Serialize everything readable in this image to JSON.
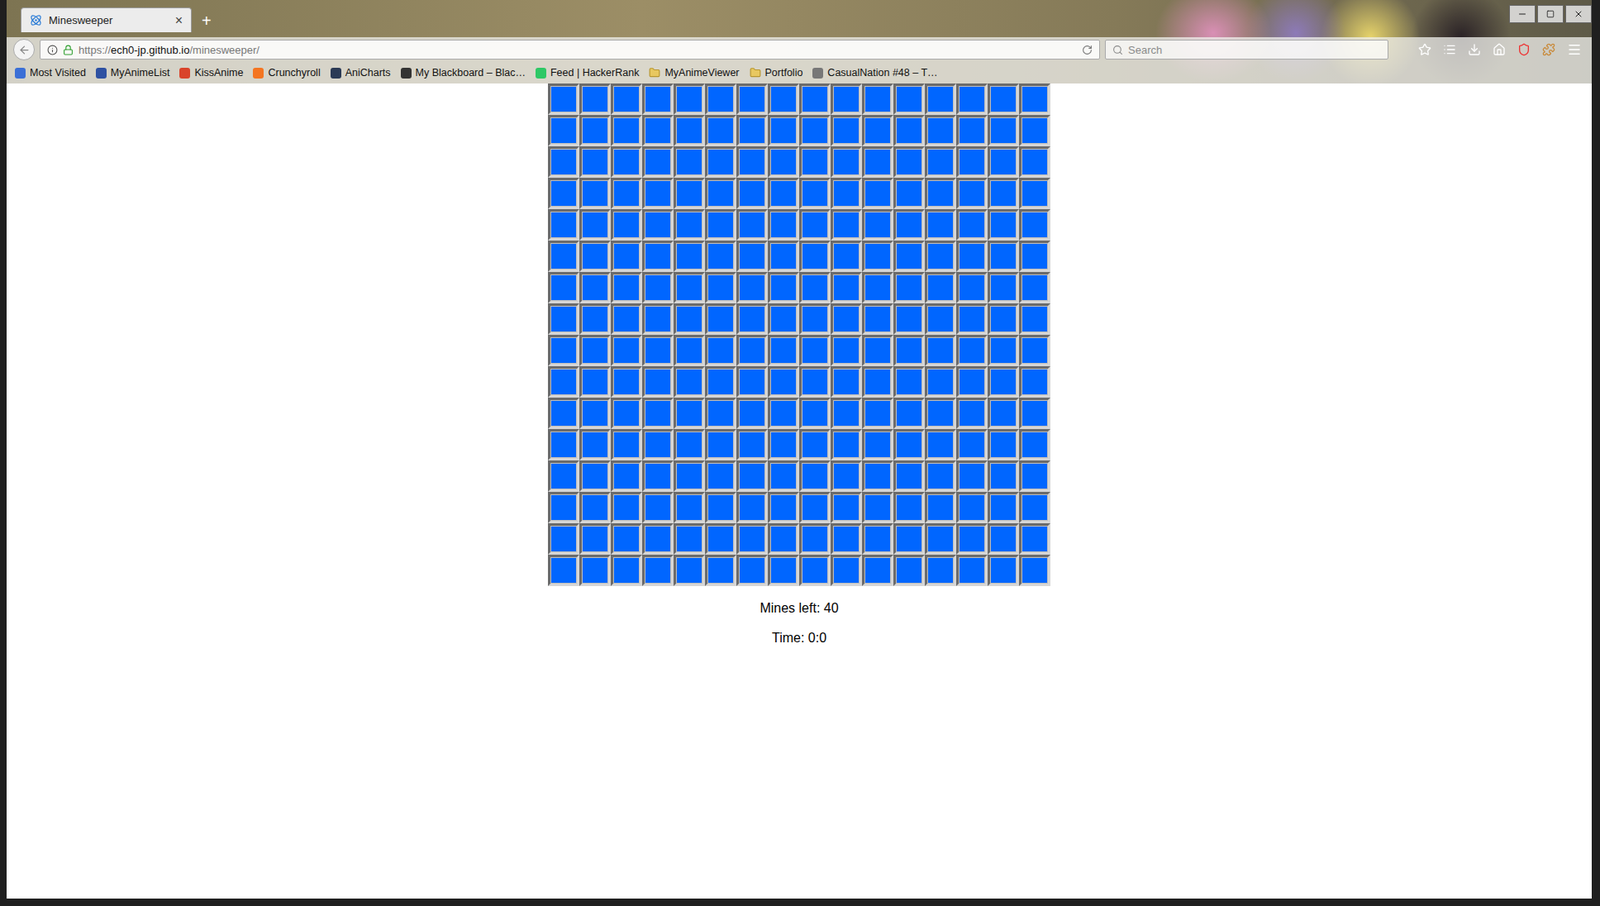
{
  "tabs": [
    {
      "label": "Minesweeper",
      "selected": true,
      "close": "×"
    }
  ],
  "new_tab": "+",
  "address_bar": {
    "scheme": "https://",
    "host": "ech0-jp.github.io",
    "path": "/minesweeper/"
  },
  "search": {
    "placeholder": "Search"
  },
  "bookmarks": [
    {
      "label": "Most Visited",
      "kind": "link",
      "color": "#3b6fd6"
    },
    {
      "label": "MyAnimeList",
      "kind": "link",
      "color": "#2e51a2"
    },
    {
      "label": "KissAnime",
      "kind": "link",
      "color": "#d9442b"
    },
    {
      "label": "Crunchyroll",
      "kind": "link",
      "color": "#f47521"
    },
    {
      "label": "AniCharts",
      "kind": "link",
      "color": "#2b3a55"
    },
    {
      "label": "My Blackboard – Blac…",
      "kind": "link",
      "color": "#333333"
    },
    {
      "label": "Feed | HackerRank",
      "kind": "link",
      "color": "#2ec866"
    },
    {
      "label": "MyAnimeViewer",
      "kind": "folder",
      "color": "#e8c860"
    },
    {
      "label": "Portfolio",
      "kind": "folder",
      "color": "#e8c860"
    },
    {
      "label": "CasualNation #48 – T…",
      "kind": "link",
      "color": "#777777"
    }
  ],
  "board": {
    "rows": [
      [
        {
          "revealed": false
        },
        {
          "revealed": false
        },
        {
          "revealed": false
        },
        {
          "revealed": false
        },
        {
          "revealed": false
        },
        {
          "revealed": false
        },
        {
          "revealed": false
        },
        {
          "revealed": false
        },
        {
          "revealed": false
        },
        {
          "revealed": false
        },
        {
          "revealed": false
        },
        {
          "revealed": false
        },
        {
          "revealed": false
        },
        {
          "revealed": false
        },
        {
          "revealed": false
        },
        {
          "revealed": false
        }
      ],
      [
        {
          "revealed": false
        },
        {
          "revealed": false
        },
        {
          "revealed": false
        },
        {
          "revealed": false
        },
        {
          "revealed": false
        },
        {
          "revealed": false
        },
        {
          "revealed": false
        },
        {
          "revealed": false
        },
        {
          "revealed": false
        },
        {
          "revealed": false
        },
        {
          "revealed": false
        },
        {
          "revealed": false
        },
        {
          "revealed": false
        },
        {
          "revealed": false
        },
        {
          "revealed": false
        },
        {
          "revealed": false
        }
      ],
      [
        {
          "revealed": false
        },
        {
          "revealed": false
        },
        {
          "revealed": false
        },
        {
          "revealed": false
        },
        {
          "revealed": false
        },
        {
          "revealed": false
        },
        {
          "revealed": false
        },
        {
          "revealed": false
        },
        {
          "revealed": false
        },
        {
          "revealed": false
        },
        {
          "revealed": false
        },
        {
          "revealed": false
        },
        {
          "revealed": false
        },
        {
          "revealed": false
        },
        {
          "revealed": false
        },
        {
          "revealed": false
        }
      ],
      [
        {
          "revealed": false
        },
        {
          "revealed": false
        },
        {
          "revealed": false
        },
        {
          "revealed": false
        },
        {
          "revealed": false
        },
        {
          "revealed": false
        },
        {
          "revealed": false
        },
        {
          "revealed": false
        },
        {
          "revealed": false
        },
        {
          "revealed": false
        },
        {
          "revealed": false
        },
        {
          "revealed": false
        },
        {
          "revealed": false
        },
        {
          "revealed": false
        },
        {
          "revealed": false
        },
        {
          "revealed": false
        }
      ],
      [
        {
          "revealed": false
        },
        {
          "revealed": false
        },
        {
          "revealed": false
        },
        {
          "revealed": false
        },
        {
          "revealed": false
        },
        {
          "revealed": false
        },
        {
          "revealed": false
        },
        {
          "revealed": false
        },
        {
          "revealed": false
        },
        {
          "revealed": false
        },
        {
          "revealed": false
        },
        {
          "revealed": false
        },
        {
          "revealed": false
        },
        {
          "revealed": false
        },
        {
          "revealed": false
        },
        {
          "revealed": false
        }
      ],
      [
        {
          "revealed": false
        },
        {
          "revealed": false
        },
        {
          "revealed": false
        },
        {
          "revealed": false
        },
        {
          "revealed": false
        },
        {
          "revealed": false
        },
        {
          "revealed": false
        },
        {
          "revealed": false
        },
        {
          "revealed": false
        },
        {
          "revealed": false
        },
        {
          "revealed": false
        },
        {
          "revealed": false
        },
        {
          "revealed": false
        },
        {
          "revealed": false
        },
        {
          "revealed": false
        },
        {
          "revealed": false
        }
      ],
      [
        {
          "revealed": false
        },
        {
          "revealed": false
        },
        {
          "revealed": false
        },
        {
          "revealed": false
        },
        {
          "revealed": false
        },
        {
          "revealed": false
        },
        {
          "revealed": false
        },
        {
          "revealed": false
        },
        {
          "revealed": false
        },
        {
          "revealed": false
        },
        {
          "revealed": false
        },
        {
          "revealed": false
        },
        {
          "revealed": false
        },
        {
          "revealed": false
        },
        {
          "revealed": false
        },
        {
          "revealed": false
        }
      ],
      [
        {
          "revealed": false
        },
        {
          "revealed": false
        },
        {
          "revealed": false
        },
        {
          "revealed": false
        },
        {
          "revealed": false
        },
        {
          "revealed": false
        },
        {
          "revealed": false
        },
        {
          "revealed": false
        },
        {
          "revealed": false
        },
        {
          "revealed": false
        },
        {
          "revealed": false
        },
        {
          "revealed": false
        },
        {
          "revealed": false
        },
        {
          "revealed": false
        },
        {
          "revealed": false
        },
        {
          "revealed": false
        }
      ],
      [
        {
          "revealed": false
        },
        {
          "revealed": false
        },
        {
          "revealed": false
        },
        {
          "revealed": false
        },
        {
          "revealed": false
        },
        {
          "revealed": false
        },
        {
          "revealed": false
        },
        {
          "revealed": false
        },
        {
          "revealed": false
        },
        {
          "revealed": false
        },
        {
          "revealed": false
        },
        {
          "revealed": false
        },
        {
          "revealed": false
        },
        {
          "revealed": false
        },
        {
          "revealed": false
        },
        {
          "revealed": false
        }
      ],
      [
        {
          "revealed": false
        },
        {
          "revealed": false
        },
        {
          "revealed": false
        },
        {
          "revealed": false
        },
        {
          "revealed": false
        },
        {
          "revealed": false
        },
        {
          "revealed": false
        },
        {
          "revealed": false
        },
        {
          "revealed": false
        },
        {
          "revealed": false
        },
        {
          "revealed": false
        },
        {
          "revealed": false
        },
        {
          "revealed": false
        },
        {
          "revealed": false
        },
        {
          "revealed": false
        },
        {
          "revealed": false
        }
      ],
      [
        {
          "revealed": false
        },
        {
          "revealed": false
        },
        {
          "revealed": false
        },
        {
          "revealed": false
        },
        {
          "revealed": false
        },
        {
          "revealed": false
        },
        {
          "revealed": false
        },
        {
          "revealed": false
        },
        {
          "revealed": false
        },
        {
          "revealed": false
        },
        {
          "revealed": false
        },
        {
          "revealed": false
        },
        {
          "revealed": false
        },
        {
          "revealed": false
        },
        {
          "revealed": false
        },
        {
          "revealed": false
        }
      ],
      [
        {
          "revealed": false
        },
        {
          "revealed": false
        },
        {
          "revealed": false
        },
        {
          "revealed": false
        },
        {
          "revealed": false
        },
        {
          "revealed": false
        },
        {
          "revealed": false
        },
        {
          "revealed": false
        },
        {
          "revealed": false
        },
        {
          "revealed": false
        },
        {
          "revealed": false
        },
        {
          "revealed": false
        },
        {
          "revealed": false
        },
        {
          "revealed": false
        },
        {
          "revealed": false
        },
        {
          "revealed": false
        }
      ],
      [
        {
          "revealed": false
        },
        {
          "revealed": false
        },
        {
          "revealed": false
        },
        {
          "revealed": false
        },
        {
          "revealed": false
        },
        {
          "revealed": false
        },
        {
          "revealed": false
        },
        {
          "revealed": false
        },
        {
          "revealed": false
        },
        {
          "revealed": false
        },
        {
          "revealed": false
        },
        {
          "revealed": false
        },
        {
          "revealed": false
        },
        {
          "revealed": false
        },
        {
          "revealed": false
        },
        {
          "revealed": false
        }
      ],
      [
        {
          "revealed": false
        },
        {
          "revealed": false
        },
        {
          "revealed": false
        },
        {
          "revealed": false
        },
        {
          "revealed": false
        },
        {
          "revealed": false
        },
        {
          "revealed": false
        },
        {
          "revealed": false
        },
        {
          "revealed": false
        },
        {
          "revealed": false
        },
        {
          "revealed": false
        },
        {
          "revealed": false
        },
        {
          "revealed": false
        },
        {
          "revealed": false
        },
        {
          "revealed": false
        },
        {
          "revealed": false
        }
      ],
      [
        {
          "revealed": false
        },
        {
          "revealed": false
        },
        {
          "revealed": false
        },
        {
          "revealed": false
        },
        {
          "revealed": false
        },
        {
          "revealed": false
        },
        {
          "revealed": false
        },
        {
          "revealed": false
        },
        {
          "revealed": false
        },
        {
          "revealed": false
        },
        {
          "revealed": false
        },
        {
          "revealed": false
        },
        {
          "revealed": false
        },
        {
          "revealed": false
        },
        {
          "revealed": false
        },
        {
          "revealed": false
        }
      ],
      [
        {
          "revealed": false
        },
        {
          "revealed": false
        },
        {
          "revealed": false
        },
        {
          "revealed": false
        },
        {
          "revealed": false
        },
        {
          "revealed": false
        },
        {
          "revealed": false
        },
        {
          "revealed": false
        },
        {
          "revealed": false
        },
        {
          "revealed": false
        },
        {
          "revealed": false
        },
        {
          "revealed": false
        },
        {
          "revealed": false
        },
        {
          "revealed": false
        },
        {
          "revealed": false
        },
        {
          "revealed": false
        }
      ]
    ]
  },
  "status": {
    "mines_left": "Mines left: 40",
    "time": "Time: 0:0"
  }
}
